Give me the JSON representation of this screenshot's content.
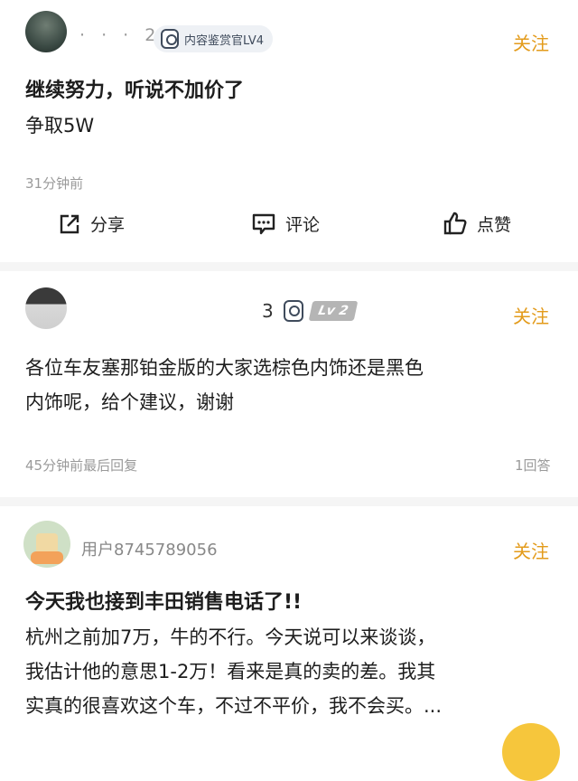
{
  "posts": [
    {
      "username": "· · · 2",
      "badge": "内容鉴赏官LV4",
      "follow": "关注",
      "lines": [
        "继续努力，听说不加价了",
        "争取5W"
      ],
      "time": "31分钟前",
      "actions": {
        "share": "分享",
        "comment": "评论",
        "like": "点赞"
      }
    },
    {
      "username": "3",
      "level": "Lv 2",
      "follow": "关注",
      "lines": [
        "各位车友塞那铂金版的大家选棕色内饰还是黑色",
        "内饰呢，给个建议，谢谢"
      ],
      "time": "45分钟前最后回复",
      "replies": "1回答"
    },
    {
      "username": "用户8745789056",
      "follow": "关注",
      "title": "今天我也接到丰田销售电话了!!",
      "lines": [
        "杭州之前加7万，牛的不行。今天说可以来谈谈，",
        "我估计他的意思1-2万！看来是真的卖的差。我其",
        "实真的很喜欢这个车，不过不平价，我不会买。..."
      ]
    }
  ],
  "icons": [
    "share-icon",
    "comment-icon",
    "like-icon",
    "badge-icon"
  ],
  "colors": {
    "follow": "#e39b1b",
    "badge_bg": "#eef1f5",
    "divider": "#f5f5f5"
  }
}
